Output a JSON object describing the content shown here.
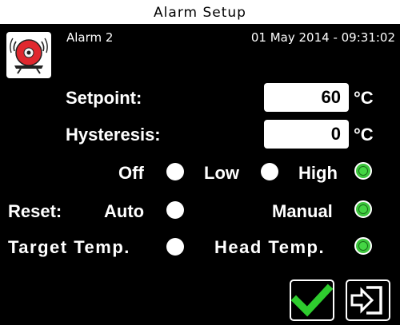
{
  "window": {
    "title": "Alarm Setup"
  },
  "header": {
    "alarm_name": "Alarm 2",
    "datetime": "01 May 2014 - 09:31:02",
    "icon": "alarm-bell-icon"
  },
  "setpoint": {
    "label": "Setpoint:",
    "value": "60",
    "unit": "°C"
  },
  "hysteresis": {
    "label": "Hysteresis:",
    "value": "0",
    "unit": "°C"
  },
  "mode": {
    "options": [
      {
        "label": "Off",
        "selected": false
      },
      {
        "label": "Low",
        "selected": false
      },
      {
        "label": "High",
        "selected": true
      }
    ]
  },
  "reset": {
    "label": "Reset:",
    "options": [
      {
        "label": "Auto",
        "selected": false
      },
      {
        "label": "Manual",
        "selected": true
      }
    ]
  },
  "target": {
    "options": [
      {
        "label": "Target Temp.",
        "selected": false
      },
      {
        "label": "Head Temp.",
        "selected": true
      }
    ]
  },
  "buttons": {
    "confirm_icon": "checkmark-icon",
    "exit_icon": "exit-icon"
  },
  "colors": {
    "selected_radio": "#3cc63c",
    "confirm": "#2ecc2e",
    "bell": "#e0282f"
  }
}
